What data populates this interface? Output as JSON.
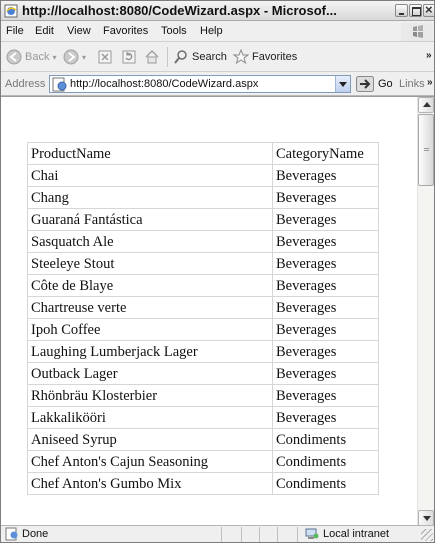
{
  "window": {
    "title": "http://localhost:8080/CodeWizard.aspx - Microsof..."
  },
  "menu": {
    "items": [
      "File",
      "Edit",
      "View",
      "Favorites",
      "Tools",
      "Help"
    ]
  },
  "toolbar": {
    "back_label": "Back",
    "search_label": "Search",
    "favorites_label": "Favorites",
    "more_symbol": "»"
  },
  "address": {
    "label": "Address",
    "url": "http://localhost:8080/CodeWizard.aspx",
    "go_label": "Go",
    "links_label": "Links",
    "links_more": "»"
  },
  "table": {
    "headers": [
      "ProductName",
      "CategoryName"
    ],
    "rows": [
      [
        "Chai",
        "Beverages"
      ],
      [
        "Chang",
        "Beverages"
      ],
      [
        "Guaraná Fantástica",
        "Beverages"
      ],
      [
        "Sasquatch Ale",
        "Beverages"
      ],
      [
        "Steeleye Stout",
        "Beverages"
      ],
      [
        "Côte de Blaye",
        "Beverages"
      ],
      [
        "Chartreuse verte",
        "Beverages"
      ],
      [
        "Ipoh Coffee",
        "Beverages"
      ],
      [
        "Laughing Lumberjack Lager",
        "Beverages"
      ],
      [
        "Outback Lager",
        "Beverages"
      ],
      [
        "Rhönbräu Klosterbier",
        "Beverages"
      ],
      [
        "Lakkalikööri",
        "Beverages"
      ],
      [
        "Aniseed Syrup",
        "Condiments"
      ],
      [
        "Chef Anton's Cajun Seasoning",
        "Condiments"
      ],
      [
        "Chef Anton's Gumbo Mix",
        "Condiments"
      ]
    ]
  },
  "status": {
    "text": "Done",
    "zone": "Local intranet"
  },
  "colors": {
    "chrome": "#efefef",
    "address_border": "#7f9db9",
    "grid_line": "#d6d6d6"
  }
}
